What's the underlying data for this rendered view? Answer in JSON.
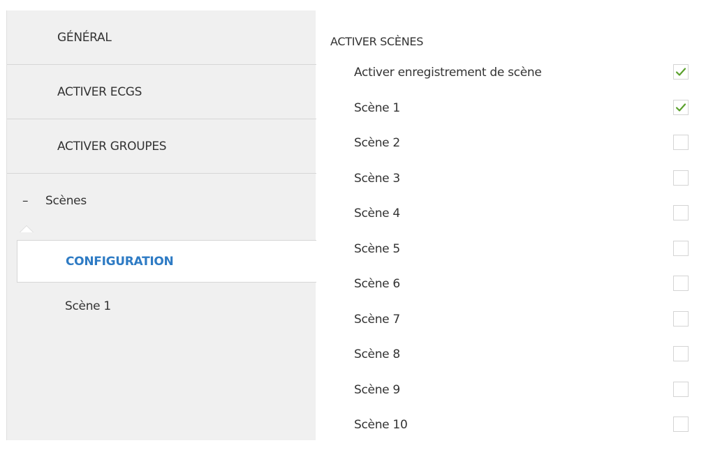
{
  "sidebar": {
    "items": [
      {
        "label": "GÉNÉRAL"
      },
      {
        "label": "ACTIVER ECGS"
      },
      {
        "label": "ACTIVER GROUPES"
      }
    ],
    "expander": {
      "toggle": "–",
      "label": "Scènes"
    },
    "subitems": [
      {
        "label": "CONFIGURATION",
        "active": true
      },
      {
        "label": "Scène 1",
        "active": false
      }
    ]
  },
  "panel": {
    "section_title": "ACTIVER SCÈNES",
    "options": [
      {
        "label": "Activer enregistrement de scène",
        "checked": true
      },
      {
        "label": "Scène 1",
        "checked": true
      },
      {
        "label": "Scène 2",
        "checked": false
      },
      {
        "label": "Scène 3",
        "checked": false
      },
      {
        "label": "Scène 4",
        "checked": false
      },
      {
        "label": "Scène 5",
        "checked": false
      },
      {
        "label": "Scène 6",
        "checked": false
      },
      {
        "label": "Scène 7",
        "checked": false
      },
      {
        "label": "Scène 8",
        "checked": false
      },
      {
        "label": "Scène 9",
        "checked": false
      },
      {
        "label": "Scène 10",
        "checked": false
      }
    ]
  },
  "colors": {
    "accent": "#2e7bc4",
    "check": "#5aa02c",
    "sidebar_bg": "#f0f0f0"
  }
}
